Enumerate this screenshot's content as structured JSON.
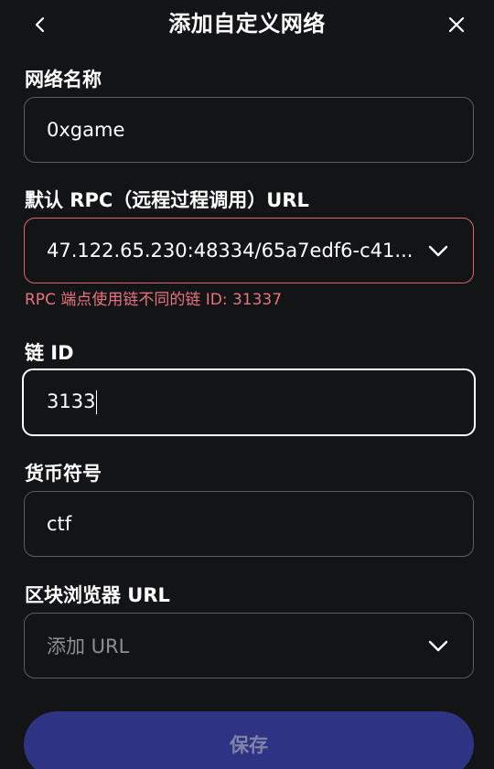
{
  "header": {
    "title": "添加自定义网络",
    "back_icon": "chevron-left-icon",
    "close_icon": "close-icon"
  },
  "form": {
    "network_name": {
      "label": "网络名称",
      "value": "0xgame"
    },
    "rpc_url": {
      "label": "默认 RPC（远程过程调用）URL",
      "value": "47.122.65.230:48334/65a7edf6-c41...",
      "error": "RPC 端点使用链不同的链 ID: 31337"
    },
    "chain_id": {
      "label": "链 ID",
      "value": "3133"
    },
    "currency_symbol": {
      "label": "货币符号",
      "value": "ctf"
    },
    "block_explorer": {
      "label": "区块浏览器 URL",
      "placeholder": "添加 URL"
    }
  },
  "actions": {
    "save_label": "保存"
  },
  "colors": {
    "background": "#131416",
    "border": "#5a5d63",
    "error": "#e06470",
    "primary_button": "#2e3383",
    "primary_button_text": "#7f84a8"
  }
}
